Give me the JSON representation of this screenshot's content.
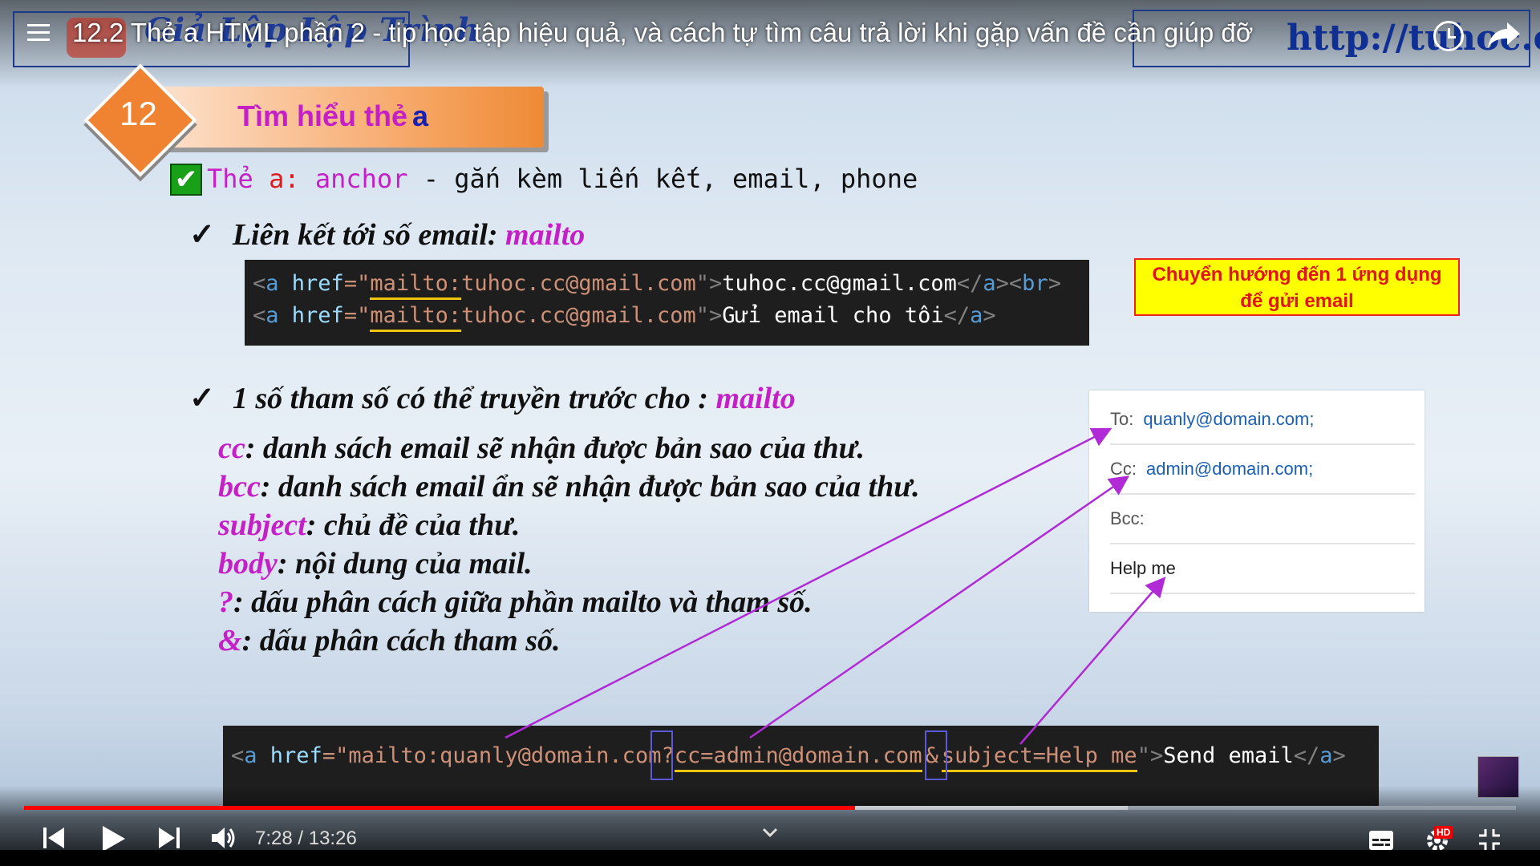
{
  "header": {
    "title": "12.2 Thẻ a HTML phần 2 - tip học tập hiệu quả, và cách tự tìm câu trả lời khi gặp vấn đề cần giúp đỡ",
    "logo_text": "Giả Lập Lập Trình",
    "site_text": "http://tuhoc.cc"
  },
  "slide": {
    "badge_number": "12",
    "badge_title": "Tìm hiểu thẻ",
    "badge_title_tag": "a",
    "intro_check": "✔",
    "intro": {
      "the": "Thẻ",
      "a": "a:",
      "anchor": "anchor",
      "rest": " - gắn kèm liến kết, email, phone"
    },
    "bullet1": {
      "mark": "✓",
      "text": "Liên kết tới số email: ",
      "keyword": "mailto"
    },
    "code1": {
      "line1": [
        "<",
        "a",
        " href",
        "=\"",
        "mailto:",
        "tuhoc.cc@gmail.com",
        "\">",
        "tuhoc.cc@gmail.com",
        "</",
        "a",
        ">",
        "<",
        "br",
        ">"
      ],
      "line2": [
        "<",
        "a",
        " href",
        "=\"",
        "mailto:",
        "tuhoc.cc@gmail.com",
        "\">",
        "Gửi email cho tôi",
        "</",
        "a",
        ">"
      ]
    },
    "note": {
      "line1": "Chuyển hướng đến 1 ứng dụng",
      "line2": "để gửi email"
    },
    "bullet2": {
      "mark": "✓",
      "text": "1 số tham số có thể truyền trước cho  : ",
      "keyword": "mailto"
    },
    "params": [
      {
        "key": "cc",
        "desc": ": danh sách email sẽ nhận được bản sao của thư."
      },
      {
        "key": "bcc",
        "desc": ": danh sách email ẩn sẽ nhận được bản sao của thư."
      },
      {
        "key": "subject",
        "desc": ": chủ đề của thư."
      },
      {
        "key": "body",
        "desc": ": nội dung của mail."
      },
      {
        "key": "?",
        "desc": ": dấu phân cách giữa phần mailto và tham số."
      },
      {
        "key": "&",
        "desc": ": dấu phân cách tham số."
      }
    ],
    "email_panel": {
      "to_label": "To:",
      "to_value": "quanly@domain.com;",
      "cc_label": "Cc:",
      "cc_value": "admin@domain.com;",
      "bcc_label": "Bcc:",
      "subject_value": "Help me"
    },
    "code2": [
      "<",
      "a",
      " href",
      "=\"mailto:quanly@domain.com",
      "?",
      "cc=admin@domain.com",
      "&",
      "subject=Help me",
      "\">",
      "Send email",
      "</",
      "a",
      ">"
    ]
  },
  "player": {
    "time_current": "7:28",
    "time_separator": " / ",
    "time_total": "13:26",
    "progress_played_fraction": 0.557,
    "progress_buffered_fraction": 0.74,
    "hd_badge": "HD",
    "colors": {
      "played": "#ff0000",
      "accent_pink": "#c51fc7"
    }
  }
}
